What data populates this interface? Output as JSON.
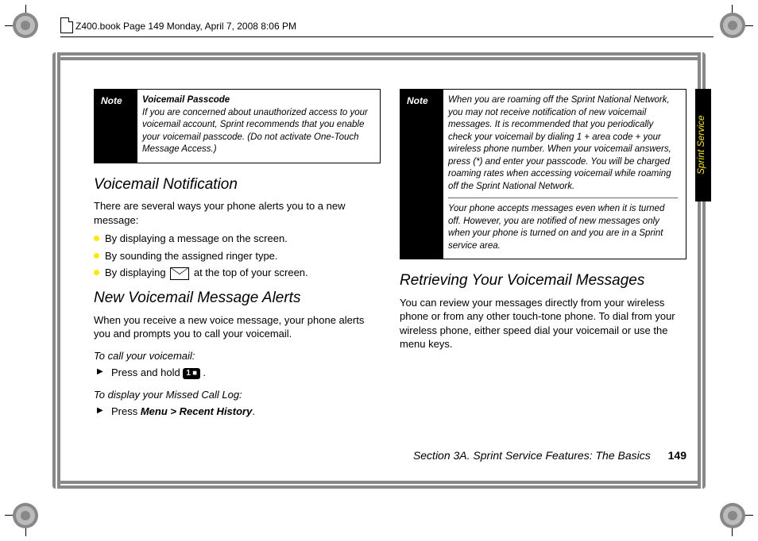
{
  "header": "Z400.book  Page 149  Monday, April 7, 2008  8:06 PM",
  "sideTab": "Sprint Service",
  "footer": {
    "section": "Section 3A. Sprint Service Features: The Basics",
    "page": "149"
  },
  "left": {
    "note": {
      "label": "Note",
      "title": "Voicemail Passcode",
      "body": "If you are concerned about unauthorized access to your voicemail account, Sprint recommends that you enable your voicemail passcode. (Do not activate One-Touch Message Access.)"
    },
    "h1": "Voicemail Notification",
    "p1": "There are several ways your phone alerts you to a new message:",
    "bullets": {
      "b1": "By displaying a message on the screen.",
      "b2": "By sounding the assigned ringer type.",
      "b3a": "By displaying ",
      "b3b": " at the top of your screen."
    },
    "h2": "New Voicemail Message Alerts",
    "p2": "When you receive a new voice message, your phone alerts you and prompts you to call your voicemail.",
    "task1": "To call your voicemail:",
    "step1a": "Press and hold ",
    "key1": "1 ⏹",
    "step1b": ".",
    "task2": "To display your Missed Call Log:",
    "step2a": "Press ",
    "step2menu": "Menu > Recent History",
    "step2b": "."
  },
  "right": {
    "note": {
      "label": "Note",
      "body1": "When you are roaming off the Sprint National Network, you may not receive notification of new voicemail messages. It is recommended that you periodically check your voicemail by dialing 1 + area code + your wireless phone number. When your voicemail answers, press (*) and enter your passcode. You will be charged roaming rates when accessing voicemail while roaming off the Sprint National Network.",
      "body2": "Your phone accepts messages even when it is turned off. However, you are notified of new messages only when your phone is turned on and you are in a Sprint service area."
    },
    "h1": "Retrieving Your Voicemail Messages",
    "p1": "You can review your messages directly from your wireless phone or from any other touch-tone phone. To dial from your wireless phone, either speed dial your voicemail or use the menu keys."
  }
}
